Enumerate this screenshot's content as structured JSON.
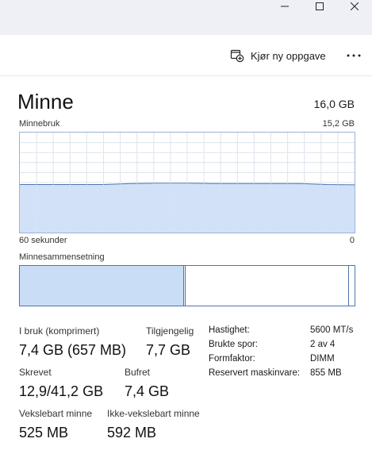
{
  "window": {
    "controls": [
      "minimize",
      "maximize",
      "close"
    ]
  },
  "toolbar": {
    "run_task_label": "Kjør ny oppgave",
    "more_label": "..."
  },
  "memory": {
    "title": "Minne",
    "total": "16,0 GB",
    "usage_label": "Minnebruk",
    "usage_max": "15,2 GB",
    "time_start_label": "60 sekunder",
    "time_end_label": "0",
    "composition_label": "Minnesammensetning",
    "composition": {
      "in_use_fraction": 0.49,
      "modified_fraction": 0.005,
      "standby_fraction": 0.485,
      "free_fraction": 0.02
    },
    "stats": {
      "in_use_label": "I bruk (komprimert)",
      "in_use_value": "7,4 GB (657 MB)",
      "available_label": "Tilgjengelig",
      "available_value": "7,7 GB",
      "committed_label": "Skrevet",
      "committed_value": "12,9/41,2 GB",
      "cached_label": "Bufret",
      "cached_value": "7,4 GB",
      "paged_label": "Vekslebart minne",
      "paged_value": "525 MB",
      "nonpaged_label": "Ikke-vekslebart minne",
      "nonpaged_value": "592 MB"
    },
    "specs": [
      {
        "label": "Hastighet:",
        "value": "5600 MT/s"
      },
      {
        "label": "Brukte spor:",
        "value": "2 av 4"
      },
      {
        "label": "Formfaktor:",
        "value": "DIMM"
      },
      {
        "label": "Reservert maskinvare:",
        "value": "855 MB"
      }
    ]
  },
  "chart_data": {
    "type": "area",
    "x": [
      60,
      55,
      50,
      45,
      40,
      35,
      30,
      25,
      20,
      15,
      10,
      5,
      0
    ],
    "values": [
      7.3,
      7.3,
      7.3,
      7.3,
      7.45,
      7.5,
      7.5,
      7.45,
      7.45,
      7.45,
      7.45,
      7.3,
      7.25
    ],
    "ylim": [
      0,
      15.2
    ],
    "xlim": [
      60,
      0
    ],
    "grid": true,
    "colors": {
      "fill": "#c9ddf7",
      "line": "#4d74b3",
      "grid": "#e0e6ef"
    }
  },
  "colors": {
    "titlebar": "#eef0f6",
    "accent": "#4d74b3",
    "fill": "#c9ddf7"
  }
}
